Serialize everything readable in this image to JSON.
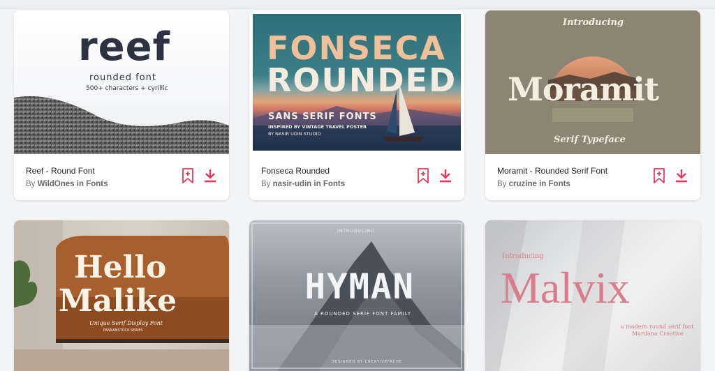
{
  "cards": [
    {
      "title": "Reef - Round Font",
      "by_prefix": "By",
      "author": "WildOnes",
      "in": "in",
      "category": "Fonts",
      "preview": {
        "name": "reef",
        "line1": "rounded font",
        "line2": "500+ characters + cyrillic"
      }
    },
    {
      "title": "Fonseca Rounded",
      "by_prefix": "By",
      "author": "nasir-udin",
      "in": "in",
      "category": "Fonts",
      "preview": {
        "line1": "FONSECA",
        "line2": "ROUNDED",
        "line3": "SANS SERIF FONTS",
        "line4": "INSPIRED BY VINTAGE TRAVEL POSTER",
        "line5": "BY NASIR UDIN STUDIO"
      }
    },
    {
      "title": "Moramit - Rounded Serif Font",
      "by_prefix": "By",
      "author": "cruzine",
      "in": "in",
      "category": "Fonts",
      "preview": {
        "intro": "Introducing",
        "name": "Moramit",
        "sub": "Serif Typeface"
      }
    },
    {
      "preview": {
        "line1": "Hello",
        "line2": "Malike",
        "sub": "Unique Serif Display Font",
        "foot": "FANNANSTOCK SERIES"
      }
    },
    {
      "preview": {
        "intro": "INTRODUCING",
        "name": "HYMAN",
        "sub": "A ROUNDED SERIF FONT FAMILY",
        "foot": "DESIGNED BY CREATIVEFACHE"
      }
    },
    {
      "preview": {
        "intro": "Introducing",
        "name": "Malvix",
        "sub1": "a modern round serif font",
        "sub2": "Mardana Creative"
      }
    }
  ],
  "colors": {
    "accent": "#e8385a",
    "link": "#666666"
  },
  "icons": {
    "bookmark": "bookmark-plus-icon",
    "download": "download-icon"
  }
}
